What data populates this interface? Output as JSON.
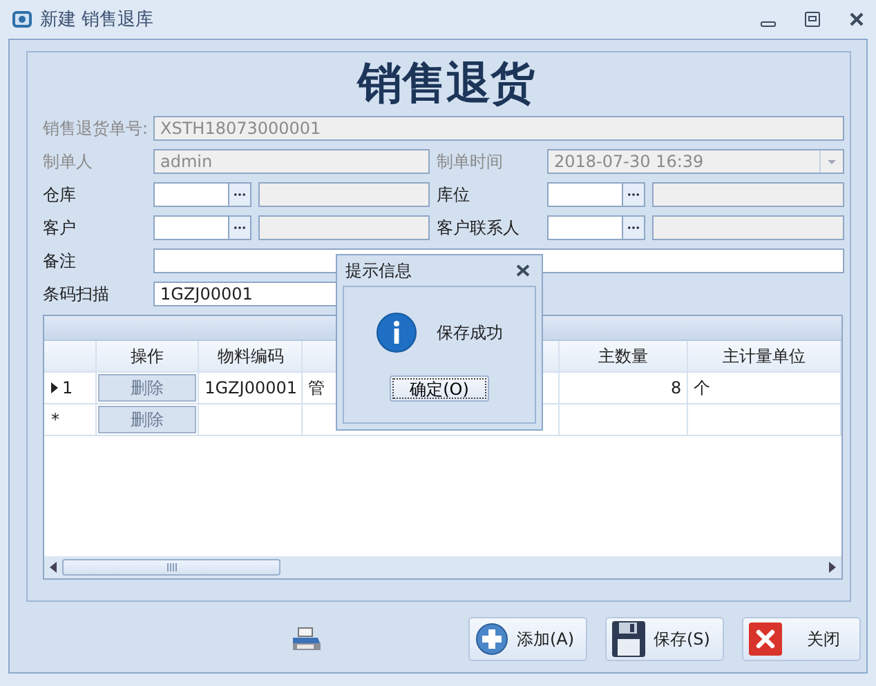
{
  "window": {
    "title": "新建 销售退库"
  },
  "form_title": "销售退货",
  "form": [
    [
      {
        "kind": "wide",
        "label": "销售退货单号:",
        "value": "XSTH18073000001",
        "disabled": true
      }
    ],
    [
      {
        "kind": "text",
        "label": "制单人",
        "value": "admin",
        "disabled": true
      },
      {
        "kind": "dropdown",
        "label": "制单时间",
        "value": "2018-07-30 16:39",
        "disabled": true
      }
    ],
    [
      {
        "kind": "lookup",
        "label": "仓库",
        "disabled": false
      },
      {
        "kind": "lookup",
        "label": "库位",
        "disabled": false
      }
    ],
    [
      {
        "kind": "lookup",
        "label": "客户",
        "disabled": false
      },
      {
        "kind": "lookup",
        "label": "客户联系人",
        "disabled": false
      }
    ],
    [
      {
        "kind": "wide",
        "label": "备注",
        "disabled": false
      }
    ],
    [
      {
        "kind": "text",
        "label": "条码扫描",
        "value": "1GZJ00001",
        "disabled": false
      }
    ]
  ],
  "table": {
    "columns": [
      {
        "kind": "button",
        "label": "操作"
      },
      {
        "kind": "text",
        "label": "物料编码"
      },
      {
        "kind": "text"
      },
      {
        "kind": "number",
        "label": "主数量"
      },
      {
        "kind": "text",
        "label": "主计量单位"
      }
    ],
    "rows": [
      {
        "marker": "1",
        "current": true,
        "cells": [
          "删除",
          "1GZJ00001",
          "管",
          "8",
          "个"
        ]
      },
      {
        "marker": "*",
        "current": false,
        "cells": [
          "删除"
        ]
      }
    ]
  },
  "buttons": [
    "添加(A)",
    "保存(S)",
    "关闭"
  ],
  "dialog": {
    "title": "提示信息",
    "message": "保存成功",
    "button": "确定(O)"
  }
}
